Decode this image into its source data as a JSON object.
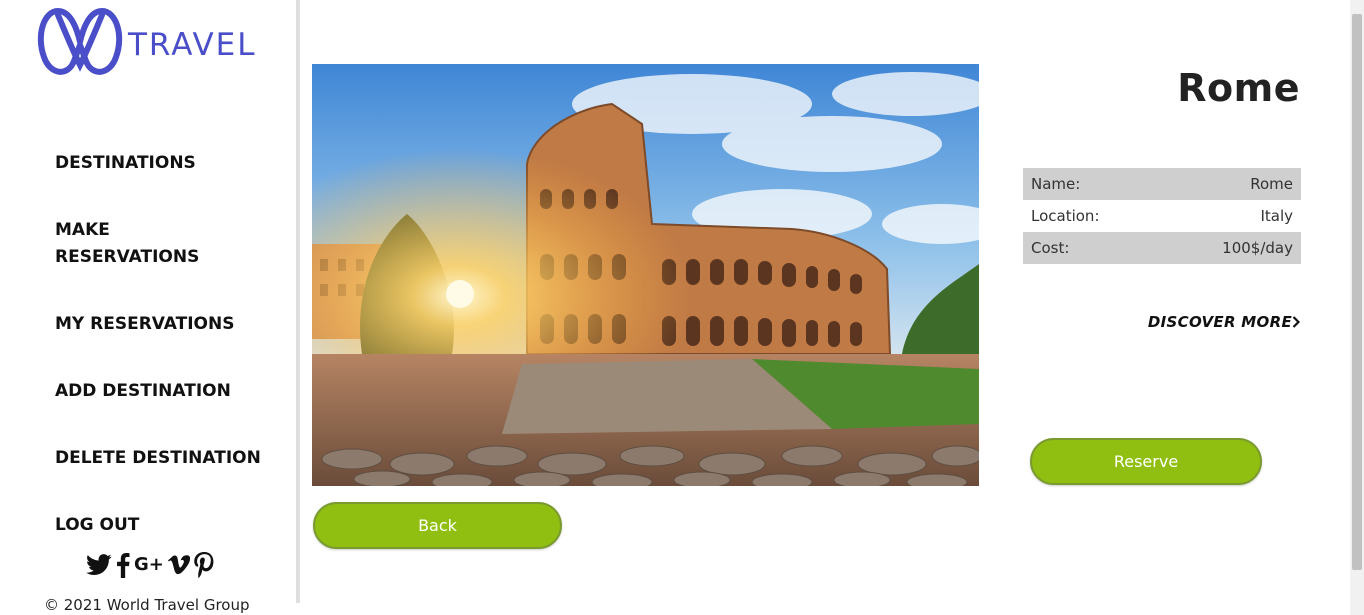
{
  "brand": {
    "logo_text": "TRAVEL",
    "color": "#4a4ec8"
  },
  "nav": {
    "items": [
      {
        "id": "destinations",
        "lines": [
          "DESTINATIONS"
        ]
      },
      {
        "id": "make-reservations",
        "lines": [
          "MAKE",
          "RESERVATIONS"
        ]
      },
      {
        "id": "my-reservations",
        "lines": [
          "MY RESERVATIONS"
        ]
      },
      {
        "id": "add-destination",
        "lines": [
          "ADD DESTINATION"
        ]
      },
      {
        "id": "delete-destination",
        "lines": [
          "DELETE DESTINATION"
        ]
      },
      {
        "id": "log-out",
        "lines": [
          "LOG OUT"
        ]
      }
    ]
  },
  "social": {
    "icons": [
      "twitter-icon",
      "facebook-icon",
      "google-plus-icon",
      "vimeo-icon",
      "pinterest-icon"
    ],
    "gplus_text": "G+"
  },
  "footer": {
    "copyright": "© 2021 World Travel Group"
  },
  "destination": {
    "title": "Rome",
    "photo_icon": "colosseum-photo",
    "details": [
      {
        "label": "Name:",
        "value": "Rome"
      },
      {
        "label": "Location:",
        "value": "Italy"
      },
      {
        "label": "Cost:",
        "value": "100$/day"
      }
    ],
    "discover_label": "DISCOVER MORE",
    "discover_icon": "chevron-right-icon"
  },
  "actions": {
    "back_label": "Back",
    "reserve_label": "Reserve",
    "accent": "#90bf12"
  }
}
